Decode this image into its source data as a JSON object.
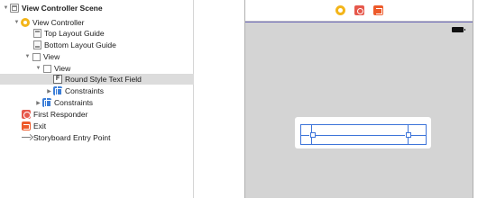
{
  "outline": {
    "items": [
      {
        "label": "View Controller Scene",
        "icon": "storyboard-scene-icon",
        "expanded": true
      },
      {
        "label": "View Controller",
        "icon": "view-controller-icon",
        "expanded": true
      },
      {
        "label": "Top Layout Guide",
        "icon": "layout-guide-icon"
      },
      {
        "label": "Bottom Layout Guide",
        "icon": "layout-guide-icon"
      },
      {
        "label": "View",
        "icon": "view-icon",
        "expanded": true
      },
      {
        "label": "View",
        "icon": "view-icon",
        "expanded": true
      },
      {
        "label": "Round Style Text Field",
        "icon": "text-field-icon",
        "selected": true
      },
      {
        "label": "Constraints",
        "icon": "constraints-icon",
        "expanded": false
      },
      {
        "label": "Constraints",
        "icon": "constraints-icon",
        "expanded": false
      },
      {
        "label": "First Responder",
        "icon": "first-responder-icon"
      },
      {
        "label": "Exit",
        "icon": "exit-icon"
      },
      {
        "label": "Storyboard Entry Point",
        "icon": "entry-point-arrow-icon"
      }
    ]
  },
  "canvas": {
    "scene_dock_icons": [
      "view-controller-icon",
      "first-responder-icon",
      "exit-icon"
    ],
    "accent_color": "#3d74d9",
    "view_background": "#d4d4d4"
  }
}
